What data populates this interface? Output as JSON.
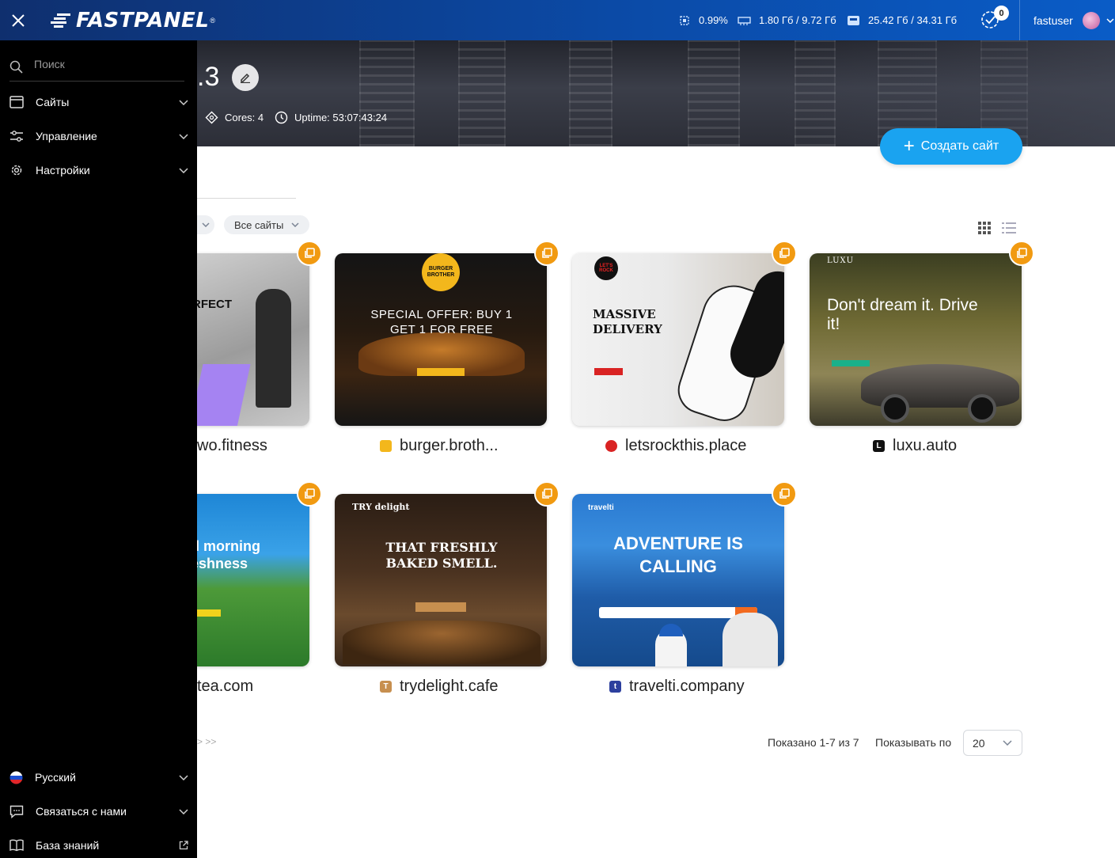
{
  "app": {
    "logo": "FASTPANEL",
    "logo_mark": "®"
  },
  "topbar": {
    "cpu": "0.99%",
    "ram": "1.80 Гб / 9.72 Гб",
    "disk": "25.42 Гб / 34.31 Гб",
    "notifications_count": "0",
    "username": "fastuser"
  },
  "server": {
    "name_fragment": ".3",
    "cores": "Cores: 4",
    "uptime": "Uptime: 53:07:43:24"
  },
  "actions": {
    "create_site": "Создать сайт"
  },
  "filters": {
    "all_sites": "Все сайты"
  },
  "sites": [
    {
      "label": "wo.fitness",
      "headline": "RFECT"
    },
    {
      "label": "burger.broth...",
      "headline": "SPECIAL OFFER: BUY 1 GET 1 FOR FREE",
      "brand": "BURGER BROTHER"
    },
    {
      "label": "letsrockthis.place",
      "headline": "MASSIVE DELIVERY",
      "brand": "LET'S ROCK"
    },
    {
      "label": "luxu.auto",
      "headline": "Don't dream it. Drive it!",
      "brand": "LUXU",
      "favicon": "L"
    },
    {
      "label": "tea.com",
      "headline": "d morning eshness"
    },
    {
      "label": "trydelight.cafe",
      "headline": "THAT FRESHLY BAKED SMELL.",
      "brand": "TRY delight",
      "favicon": "T"
    },
    {
      "label": "travelti.company",
      "headline": "ADVENTURE IS CALLING",
      "brand": "travelti",
      "favicon": "t"
    }
  ],
  "pagination": {
    "arrows": ">   >>",
    "shown": "Показано 1-7 из 7",
    "per_page_label": "Показывать по",
    "per_page_value": "20"
  },
  "sidebar": {
    "search_placeholder": "Поиск",
    "items": [
      {
        "label": "Сайты"
      },
      {
        "label": "Управление"
      },
      {
        "label": "Настройки"
      }
    ],
    "bottom": [
      {
        "label": "Русский"
      },
      {
        "label": "Связаться с нами"
      },
      {
        "label": "База знаний"
      }
    ]
  },
  "colors": {
    "accent": "#1aa3f0",
    "copy_button": "#f19a11",
    "sidebar_bg": "#000000",
    "topbar": "#0b4aa6"
  }
}
